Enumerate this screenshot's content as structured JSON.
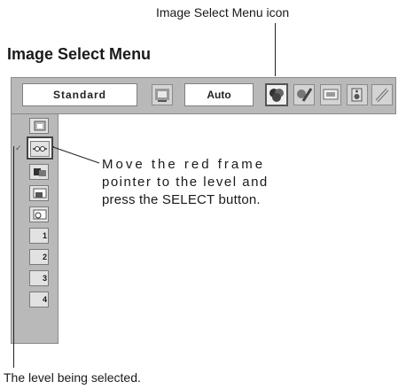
{
  "callouts": {
    "menu_icon": "Image Select Menu icon",
    "instruction_line1": "Move the red frame",
    "instruction_line2": "pointer to the level and",
    "instruction_line3": "press the SELECT button.",
    "level_selected": "The level being selected."
  },
  "page": {
    "title": "Image Select Menu"
  },
  "menubar": {
    "mode_value": "Standard",
    "auto_value": "Auto",
    "icons": [
      "picture-adjust-icon",
      "image-select-icon",
      "image-adjust-icon",
      "screen-icon",
      "sound-icon",
      "setting-icon"
    ]
  },
  "sidebar": {
    "levels": [
      "",
      "",
      "",
      "",
      "",
      "1",
      "2",
      "3",
      "4"
    ],
    "level_icons": [
      "image-level-1-icon",
      "image-level-2-icon",
      "image-level-3-icon",
      "image-level-4-icon",
      "image-level-5-icon",
      "image-level-6-icon",
      "image-level-7-icon",
      "image-level-8-icon",
      "image-level-9-icon"
    ]
  }
}
